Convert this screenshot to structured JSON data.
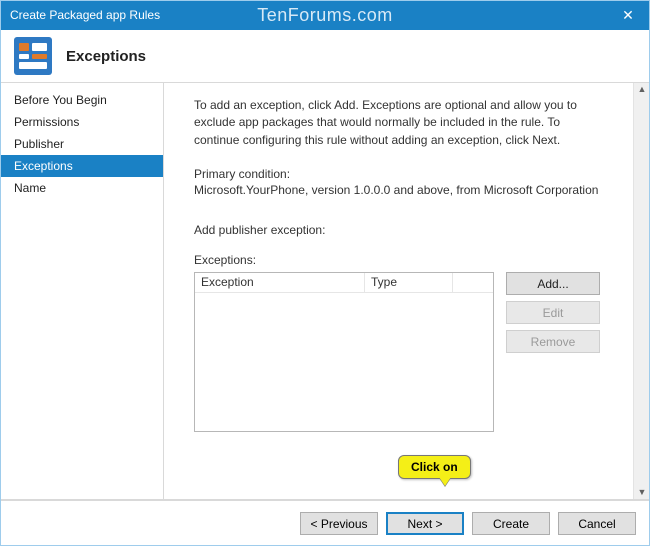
{
  "window": {
    "title": "Create Packaged app Rules",
    "watermark": "TenForums.com",
    "close_glyph": "✕"
  },
  "header": {
    "title": "Exceptions"
  },
  "sidebar": {
    "items": [
      {
        "label": "Before You Begin"
      },
      {
        "label": "Permissions"
      },
      {
        "label": "Publisher"
      },
      {
        "label": "Exceptions"
      },
      {
        "label": "Name"
      }
    ],
    "active_index": 3
  },
  "main": {
    "description": "To add an exception, click Add. Exceptions are optional and allow you to exclude app packages that would normally be included in the rule. To continue configuring this rule without adding an exception, click Next.",
    "primary_condition_label": "Primary condition:",
    "primary_condition_value": "Microsoft.YourPhone, version 1.0.0.0 and above, from Microsoft Corporation",
    "add_exception_label": "Add publisher exception:",
    "exceptions_label": "Exceptions:",
    "columns": {
      "exception": "Exception",
      "type": "Type"
    },
    "buttons": {
      "add": "Add...",
      "edit": "Edit",
      "remove": "Remove"
    }
  },
  "scroll": {
    "up": "▲",
    "down": "▼"
  },
  "footer": {
    "previous": "< Previous",
    "next": "Next >",
    "create": "Create",
    "cancel": "Cancel"
  },
  "callout": {
    "text": "Click on"
  }
}
